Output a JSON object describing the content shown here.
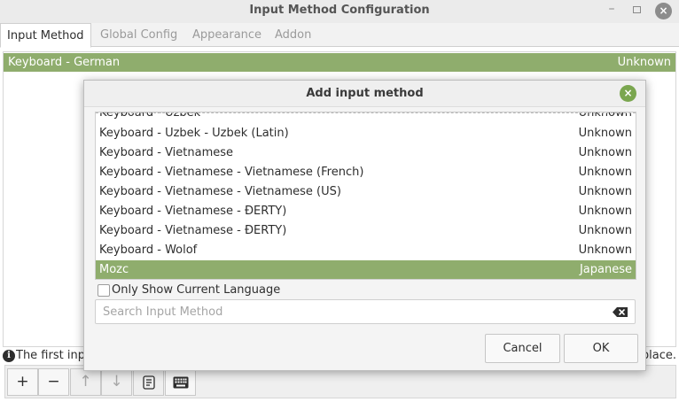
{
  "window": {
    "title": "Input Method Configuration",
    "minimize": "–",
    "close": "×"
  },
  "tabs": [
    "Input Method",
    "Global Config",
    "Appearance",
    "Addon"
  ],
  "current_list": [
    {
      "name": "Keyboard - German",
      "language": "Unknown"
    }
  ],
  "info": {
    "text_start": "The first inpu",
    "text_end": "place."
  },
  "toolbar": {
    "add": "+",
    "remove": "−",
    "up": "↑",
    "down": "↓"
  },
  "dialog": {
    "title": "Add input method",
    "close": "×",
    "list": [
      {
        "name": "Keyboard - Uzbek",
        "language": "Unknown"
      },
      {
        "name": "Keyboard - Uzbek - Uzbek (Latin)",
        "language": "Unknown"
      },
      {
        "name": "Keyboard - Vietnamese",
        "language": "Unknown"
      },
      {
        "name": "Keyboard - Vietnamese - Vietnamese (French)",
        "language": "Unknown"
      },
      {
        "name": "Keyboard - Vietnamese - Vietnamese (US)",
        "language": "Unknown"
      },
      {
        "name": "Keyboard - Vietnamese - ĐERTY)",
        "language": "Unknown"
      },
      {
        "name": "Keyboard - Vietnamese - ĐERTY)",
        "language": "Unknown"
      },
      {
        "name": "Keyboard - Wolof",
        "language": "Unknown"
      },
      {
        "name": "Mozc",
        "language": "Japanese",
        "selected": true
      }
    ],
    "only_current_language": "Only Show Current Language",
    "search_placeholder": "Search Input Method",
    "cancel": "Cancel",
    "ok": "OK"
  },
  "colors": {
    "selection": "#8fad6d",
    "dialog_close": "#7aa64f"
  }
}
